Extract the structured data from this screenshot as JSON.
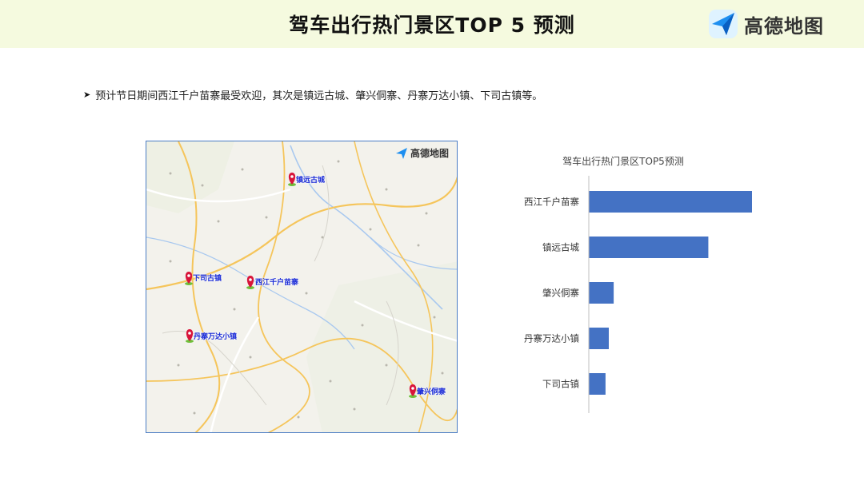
{
  "header": {
    "title": "驾车出行热门景区TOP 5 预测",
    "logo_text": "高德地图"
  },
  "bullet_text": "预计节日期间西江千户苗寨最受欢迎，其次是镇远古城、肇兴侗寨、丹寨万达小镇、下司古镇等。",
  "map": {
    "logo_text": "高德地图",
    "pins": [
      {
        "label": "镇远古城"
      },
      {
        "label": "下司古镇"
      },
      {
        "label": "西江千户苗寨"
      },
      {
        "label": "丹寨万达小镇"
      },
      {
        "label": "肇兴侗寨"
      }
    ],
    "pin_color": "#d8143a"
  },
  "chart_data": {
    "type": "bar",
    "orientation": "horizontal",
    "title": "驾车出行热门景区TOP5预测",
    "categories": [
      "西江千户苗寨",
      "镇远古城",
      "肇兴侗寨",
      "丹寨万达小镇",
      "下司古镇"
    ],
    "values": [
      100,
      73,
      15,
      12,
      10
    ],
    "xlim": [
      0,
      100
    ],
    "bar_color": "#4472c4",
    "grid": false,
    "legend": "none"
  }
}
